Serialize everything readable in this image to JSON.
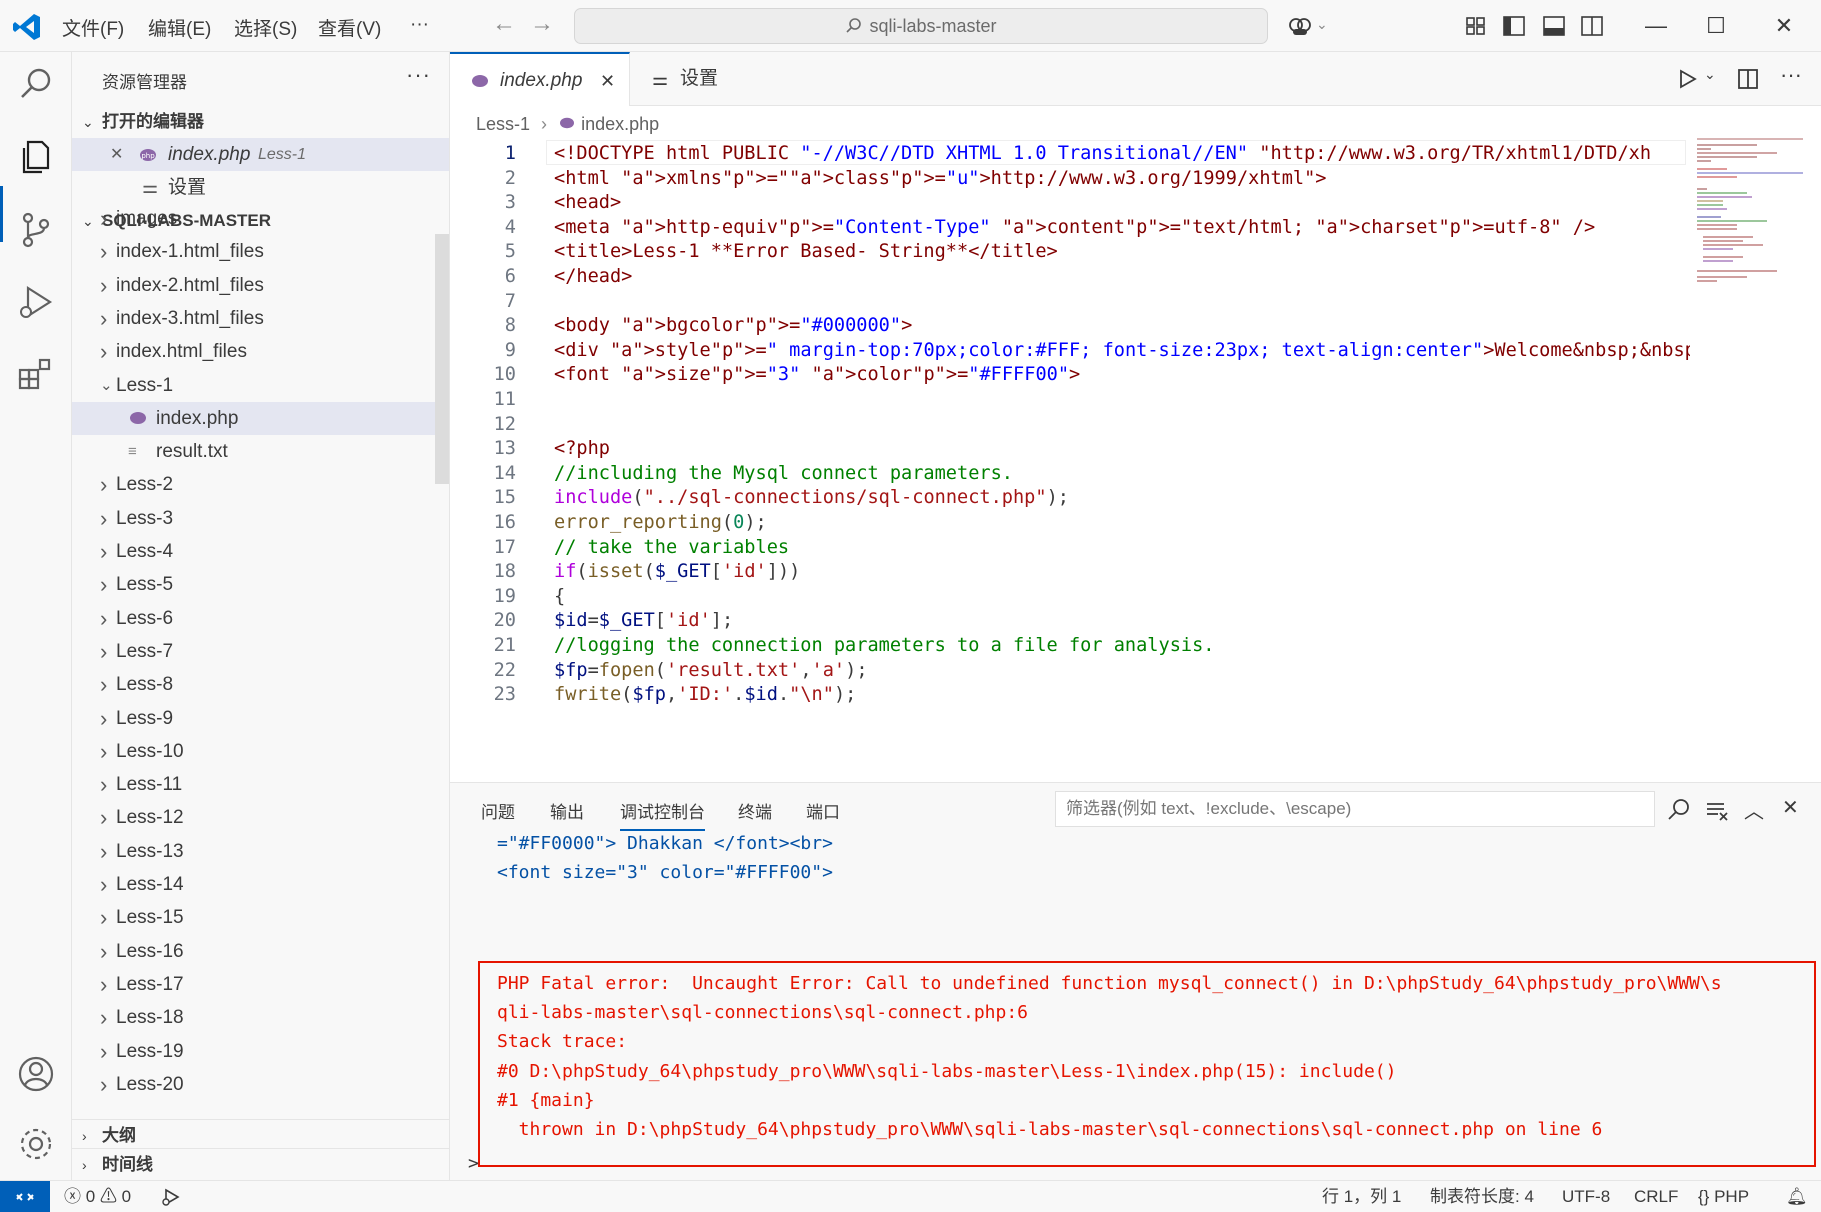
{
  "menu": {
    "file": "文件(F)",
    "edit": "编辑(E)",
    "select": "选择(S)",
    "view": "查看(V)",
    "more": "···"
  },
  "search": {
    "text": "sqli-labs-master"
  },
  "sidebar": {
    "title": "资源管理器",
    "open_editors_label": "打开的编辑器",
    "open_editors": [
      {
        "name": "index.php",
        "folder": "Less-1"
      },
      {
        "name": "设置",
        "folder": ""
      }
    ],
    "root_label": "SQLI-LABS-MASTER",
    "tree": [
      {
        "label": "images",
        "type": "folder",
        "depth": 1
      },
      {
        "label": "index-1.html_files",
        "type": "folder",
        "depth": 1
      },
      {
        "label": "index-2.html_files",
        "type": "folder",
        "depth": 1
      },
      {
        "label": "index-3.html_files",
        "type": "folder",
        "depth": 1
      },
      {
        "label": "index.html_files",
        "type": "folder",
        "depth": 1
      },
      {
        "label": "Less-1",
        "type": "folder-open",
        "depth": 1
      },
      {
        "label": "index.php",
        "type": "php",
        "depth": 2,
        "selected": true
      },
      {
        "label": "result.txt",
        "type": "txt",
        "depth": 2
      },
      {
        "label": "Less-2",
        "type": "folder",
        "depth": 1
      },
      {
        "label": "Less-3",
        "type": "folder",
        "depth": 1
      },
      {
        "label": "Less-4",
        "type": "folder",
        "depth": 1
      },
      {
        "label": "Less-5",
        "type": "folder",
        "depth": 1
      },
      {
        "label": "Less-6",
        "type": "folder",
        "depth": 1
      },
      {
        "label": "Less-7",
        "type": "folder",
        "depth": 1
      },
      {
        "label": "Less-8",
        "type": "folder",
        "depth": 1
      },
      {
        "label": "Less-9",
        "type": "folder",
        "depth": 1
      },
      {
        "label": "Less-10",
        "type": "folder",
        "depth": 1
      },
      {
        "label": "Less-11",
        "type": "folder",
        "depth": 1
      },
      {
        "label": "Less-12",
        "type": "folder",
        "depth": 1
      },
      {
        "label": "Less-13",
        "type": "folder",
        "depth": 1
      },
      {
        "label": "Less-14",
        "type": "folder",
        "depth": 1
      },
      {
        "label": "Less-15",
        "type": "folder",
        "depth": 1
      },
      {
        "label": "Less-16",
        "type": "folder",
        "depth": 1
      },
      {
        "label": "Less-17",
        "type": "folder",
        "depth": 1
      },
      {
        "label": "Less-18",
        "type": "folder",
        "depth": 1
      },
      {
        "label": "Less-19",
        "type": "folder",
        "depth": 1
      },
      {
        "label": "Less-20",
        "type": "folder",
        "depth": 1
      }
    ],
    "outline_label": "大纲",
    "timeline_label": "时间线"
  },
  "editor": {
    "tabs": [
      {
        "label": "index.php",
        "active": true
      },
      {
        "label": "设置",
        "active": false
      }
    ],
    "breadcrumb": {
      "folder": "Less-1",
      "file": "index.php"
    },
    "current_line": 1
  },
  "code_lines": [
    "<!DOCTYPE html PUBLIC \"-//W3C//DTD XHTML 1.0 Transitional//EN\" \"http://www.w3.org/TR/xhtml1/DTD/xh",
    "<html xmlns=\"http://www.w3.org/1999/xhtml\">",
    "<head>",
    "<meta http-equiv=\"Content-Type\" content=\"text/html; charset=utf-8\" />",
    "<title>Less-1 **Error Based- String**</title>",
    "</head>",
    "",
    "<body bgcolor=\"#000000\">",
    "<div style=\" margin-top:70px;color:#FFF; font-size:23px; text-align:center\">Welcome&nbsp;&nbsp;&nb",
    "<font size=\"3\" color=\"#FFFF00\">",
    "",
    "",
    "<?php",
    "//including the Mysql connect parameters.",
    "include(\"../sql-connections/sql-connect.php\");",
    "error_reporting(0);",
    "// take the variables",
    "if(isset($_GET['id']))",
    "{",
    "$id=$_GET['id'];",
    "//logging the connection parameters to a file for analysis.",
    "$fp=fopen('result.txt','a');",
    "fwrite($fp,'ID:'.$id.\"\\n\");"
  ],
  "panel": {
    "tabs": [
      "问题",
      "输出",
      "调试控制台",
      "终端",
      "端口"
    ],
    "active_tab": "调试控制台",
    "filter_placeholder": "筛选器(例如 text、!exclude、\\escape)",
    "output_lines": [
      "=\"#FF0000\"> Dhakkan </font><br>",
      "<font size=\"3\" color=\"#FFFF00\">"
    ],
    "error_lines": [
      "PHP Fatal error:  Uncaught Error: Call to undefined function mysql_connect() in D:\\phpStudy_64\\phpstudy_pro\\WWW\\s",
      "qli-labs-master\\sql-connections\\sql-connect.php:6",
      "Stack trace:",
      "#0 D:\\phpStudy_64\\phpstudy_pro\\WWW\\sqli-labs-master\\Less-1\\index.php(15): include()",
      "#1 {main}",
      "  thrown in D:\\phpStudy_64\\phpstudy_pro\\WWW\\sqli-labs-master\\sql-connections\\sql-connect.php on line 6"
    ],
    "prompt": ">"
  },
  "status": {
    "errors": "0",
    "warnings": "0",
    "position": "行 1，列 1",
    "tab_size": "制表符长度: 4",
    "encoding": "UTF-8",
    "eol": "CRLF",
    "language": "PHP"
  },
  "colors": {
    "accent": "#005fb8",
    "error": "#e51400",
    "php_icon": "#8c67a8"
  }
}
